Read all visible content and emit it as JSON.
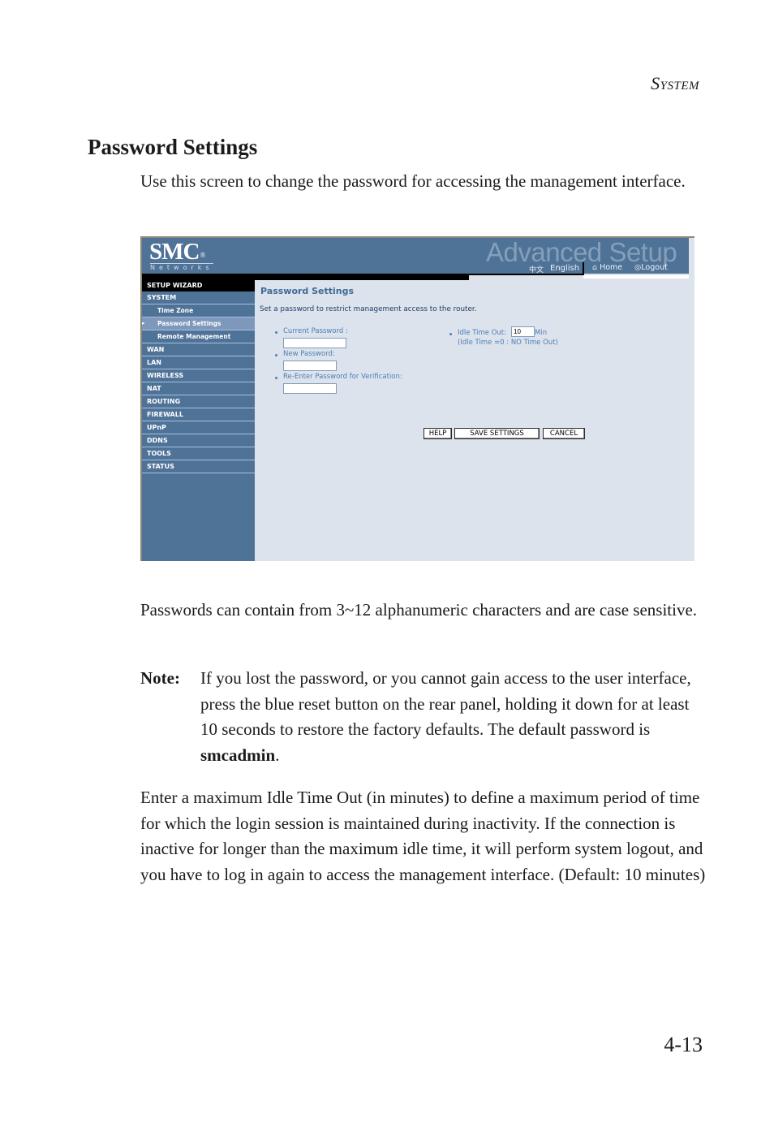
{
  "running_head": {
    "first": "S",
    "rest": "YSTEM"
  },
  "section_title": "Password Settings",
  "intro": "Use this screen to change the password for accessing the management interface.",
  "screenshot": {
    "brand": "SMC",
    "brand_registered": "®",
    "brand_tagline": "Networks",
    "banner_title": "Advanced Setup",
    "lang_chinese": "中文",
    "lang_english": "English",
    "home_link": "Home",
    "logout_link": "Logout",
    "sidebar": {
      "items": [
        {
          "label": "SETUP WIZARD"
        },
        {
          "label": "SYSTEM"
        },
        {
          "label": "Time Zone"
        },
        {
          "label": "Password Settings"
        },
        {
          "label": "Remote Management"
        },
        {
          "label": "WAN"
        },
        {
          "label": "LAN"
        },
        {
          "label": "WIRELESS"
        },
        {
          "label": "NAT"
        },
        {
          "label": "ROUTING"
        },
        {
          "label": "FIREWALL"
        },
        {
          "label": "UPnP"
        },
        {
          "label": "DDNS"
        },
        {
          "label": "TOOLS"
        },
        {
          "label": "STATUS"
        }
      ],
      "active_marker": "▸"
    },
    "content": {
      "title": "Password Settings",
      "description": "Set a password to restrict management access to the router.",
      "current_password_label": "Current Password :",
      "current_password_value": "",
      "new_password_label": "New Password:",
      "new_password_value": "",
      "reenter_password_label": "Re-Enter Password for Verification:",
      "reenter_password_value": "",
      "idle_timeout_label": "Idle Time Out:",
      "idle_timeout_value": "10",
      "idle_timeout_unit": "Min",
      "idle_timeout_hint": "(Idle Time =0 : NO Time Out)",
      "buttons": {
        "help": "HELP",
        "save": "SAVE SETTINGS",
        "cancel": "CANCEL"
      }
    }
  },
  "chars_paragraph": "Passwords can contain from 3~12 alphanumeric characters and are case sensitive.",
  "note": {
    "label": "Note:",
    "text_before": "If you lost the password, or you cannot gain access to the user interface, press the blue reset button on the rear panel, holding it down for at least 10 seconds to restore the factory defaults. The default password is ",
    "default_password": "smcadmin",
    "text_after": "."
  },
  "idle_paragraph": "Enter a maximum Idle Time Out (in minutes) to define a maximum period of time for which the login session is maintained during inactivity. If the connection is inactive for longer than the maximum idle time, it will perform system logout, and you have to log in again to access the management interface. (Default: 10 minutes)",
  "page_number": "4-13"
}
